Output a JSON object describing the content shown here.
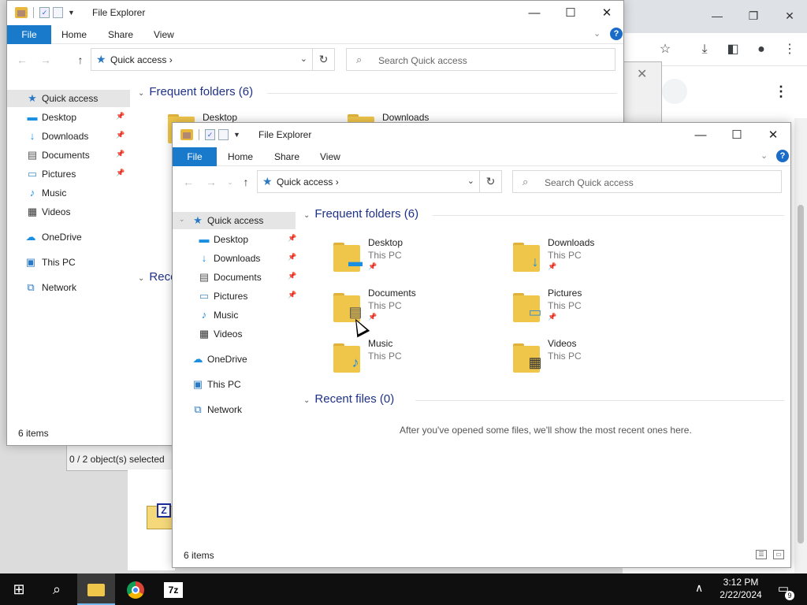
{
  "chrome": {
    "minimize": "—",
    "restore": "❐",
    "close": "✕",
    "toolbar_icons": [
      "star-icon",
      "download-icon",
      "sidepanel-icon",
      "profile-icon",
      "menu-icon"
    ],
    "menu": "⋮"
  },
  "background_dialog": {
    "status": "0 / 2 object(s) selected",
    "close": "✕",
    "zip_letter": "Z"
  },
  "back_window": {
    "title": "File Explorer",
    "tabs": [
      "File",
      "Home",
      "Share",
      "View"
    ],
    "address": "Quick access",
    "search_placeholder": "Search Quick access",
    "sidebar": [
      {
        "label": "Quick access",
        "icon": "★",
        "selected": true
      },
      {
        "label": "Desktop",
        "icon": "▬",
        "pinned": true
      },
      {
        "label": "Downloads",
        "icon": "↓",
        "pinned": true
      },
      {
        "label": "Documents",
        "icon": "▤",
        "pinned": true
      },
      {
        "label": "Pictures",
        "icon": "▭",
        "pinned": true
      },
      {
        "label": "Music",
        "icon": "♪"
      },
      {
        "label": "Videos",
        "icon": "▦"
      },
      {
        "label": "OneDrive",
        "icon": "☁"
      },
      {
        "label": "This PC",
        "icon": "▣"
      },
      {
        "label": "Network",
        "icon": "⧉"
      }
    ],
    "frequent_header": "Frequent folders (6)",
    "recent_header_partial": "Rece",
    "visible_folders": [
      "Desktop",
      "Downloads"
    ],
    "status": "6 items"
  },
  "front_window": {
    "title": "File Explorer",
    "tabs": [
      "File",
      "Home",
      "Share",
      "View"
    ],
    "address": "Quick access",
    "search_placeholder": "Search Quick access",
    "sidebar": [
      {
        "label": "Quick access",
        "icon": "★",
        "selected": true
      },
      {
        "label": "Desktop",
        "icon": "▬",
        "pinned": true
      },
      {
        "label": "Downloads",
        "icon": "↓",
        "pinned": true
      },
      {
        "label": "Documents",
        "icon": "▤",
        "pinned": true
      },
      {
        "label": "Pictures",
        "icon": "▭",
        "pinned": true
      },
      {
        "label": "Music",
        "icon": "♪"
      },
      {
        "label": "Videos",
        "icon": "▦"
      },
      {
        "label": "OneDrive",
        "icon": "☁"
      },
      {
        "label": "This PC",
        "icon": "▣"
      },
      {
        "label": "Network",
        "icon": "⧉"
      }
    ],
    "frequent_header": "Frequent folders (6)",
    "folders": [
      {
        "name": "Desktop",
        "location": "This PC",
        "pinned": true,
        "icon": "▬",
        "icon_color": "#1a8ee0"
      },
      {
        "name": "Downloads",
        "location": "This PC",
        "pinned": true,
        "icon": "↓",
        "icon_color": "#1a8ee0"
      },
      {
        "name": "Documents",
        "location": "This PC",
        "pinned": true,
        "icon": "▤",
        "icon_color": "#555555"
      },
      {
        "name": "Pictures",
        "location": "This PC",
        "pinned": true,
        "icon": "▭",
        "icon_color": "#4a90c0"
      },
      {
        "name": "Music",
        "location": "This PC",
        "pinned": false,
        "icon": "♪",
        "icon_color": "#1a8ee0"
      },
      {
        "name": "Videos",
        "location": "This PC",
        "pinned": false,
        "icon": "▦",
        "icon_color": "#333333"
      }
    ],
    "recent_header": "Recent files (0)",
    "recent_empty": "After you've opened some files, we'll show the most recent ones here.",
    "status": "6 items"
  },
  "taskbar": {
    "time": "3:12 PM",
    "date": "2/22/2024",
    "notification_count": "9",
    "apps": [
      "windows-start",
      "search",
      "file-explorer",
      "chrome",
      "7zip"
    ],
    "zip_label": "7z"
  },
  "colors": {
    "accent": "#1979ca",
    "group_header": "#1e3287",
    "folder": "#f0c64a"
  }
}
